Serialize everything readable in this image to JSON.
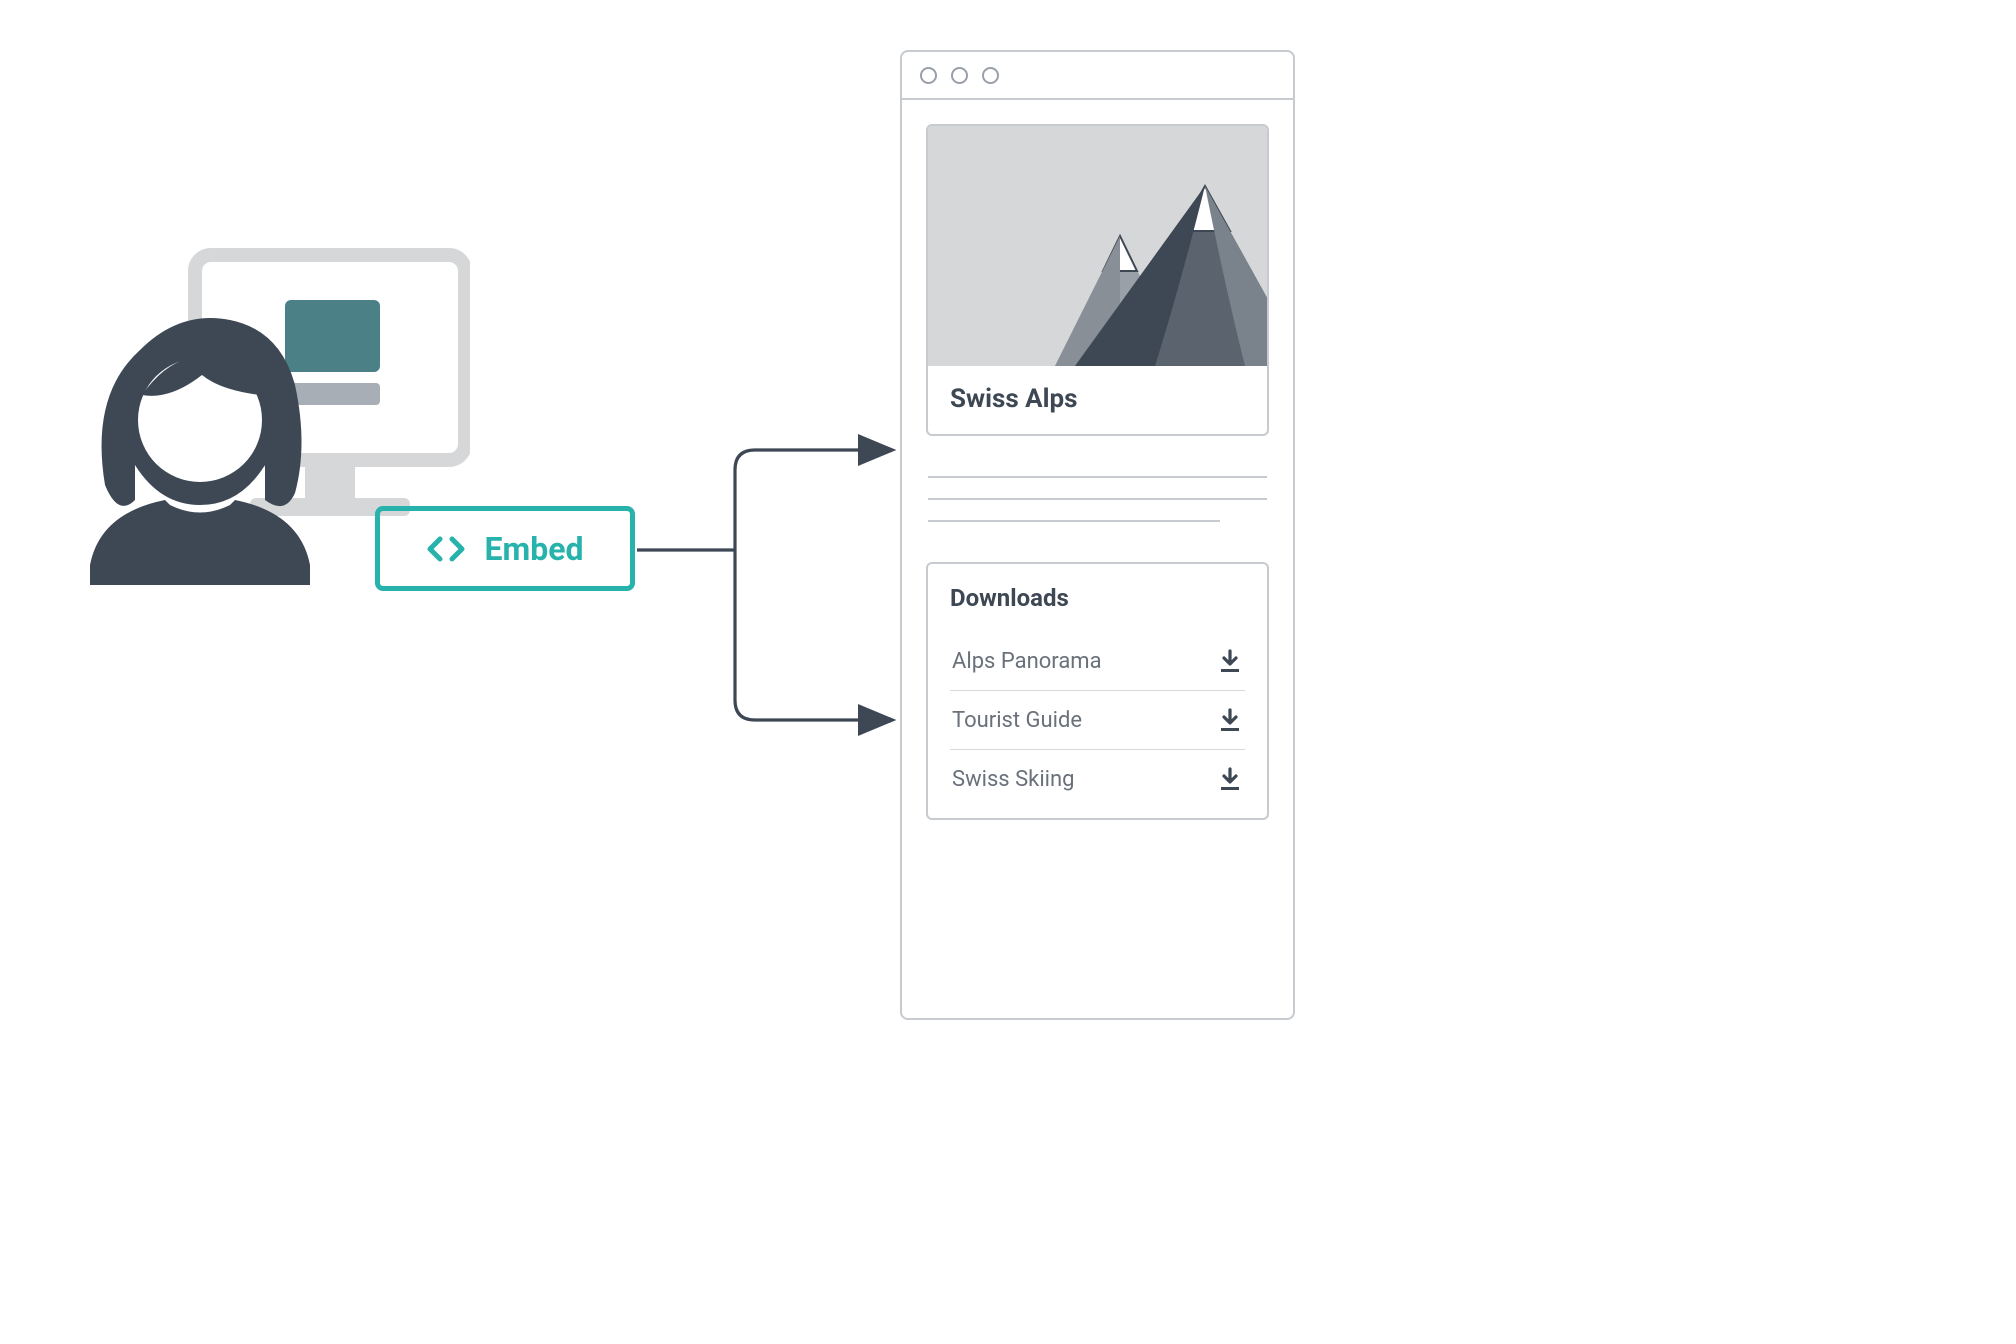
{
  "embed": {
    "label": "Embed",
    "icon": "code-icon"
  },
  "webpage": {
    "card_title": "Swiss Alps",
    "downloads_title": "Downloads",
    "downloads": [
      {
        "label": "Alps Panorama"
      },
      {
        "label": "Tourist Guide"
      },
      {
        "label": "Swiss Skiing"
      }
    ]
  },
  "colors": {
    "accent": "#27b3ac",
    "gray": "#3e4854",
    "light_gray": "#c7cbd0",
    "muted": "#6a717a"
  }
}
